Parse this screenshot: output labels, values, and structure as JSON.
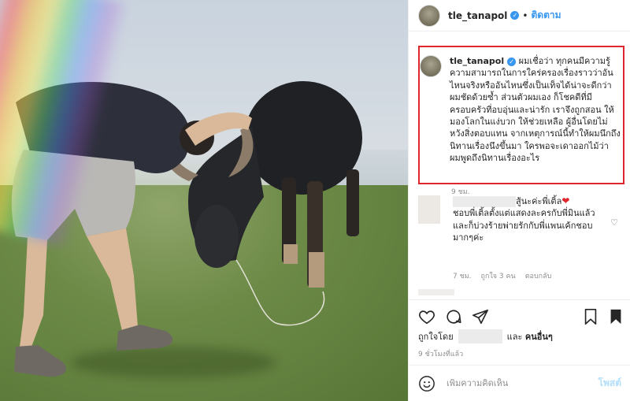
{
  "post": {
    "username": "tle_tanapol",
    "follow_label": "ติดตาม",
    "separator": "•",
    "verified_icon": "verified-badge-icon"
  },
  "caption": {
    "username": "tle_tanapol",
    "text": "ผมเชื่อว่า ทุกคนมีความรู้ความสามารถในการใคร่ครองเรื่องราวว่าอันไหนจริงหรืออันไหนซึ่งเป็นเท็จได้น่าจะดีกว่าผมชัดด้วยซ้ำ ส่วนตัวผมเอง ก็โชคดีที่มีครอบครัวที่อบอุ่นและน่ารัก เราจึงถูกสอน ให้มองโลกในแง่บวก ให้ช่วยเหลือ ผู้อื่นโดยไม่หวังสิ่งตอบแทน จากเหตุการณ์นี้ทำให้ผมนึกถึงนิทานเรื่องนึงขึ้นมา ใครพอจะเดาออกไม้ว่า ผมพูดถึงนิทานเรื่องอะไร",
    "time": "9 ชม."
  },
  "comment": {
    "text_line1_suffix": "สู้นะค่ะพี่เติ้ล",
    "text_rest": "ชอบพี่เติ้ลตั้งแต่แสดงละครกับพี่มินแล้วและก็บ่วงร้ายพ่ายรักกับพี่แพนเค้กชอบมากๆค่ะ",
    "time": "7 ชม.",
    "likes": "ถูกใจ 3 คน",
    "reply": "ตอบกลับ"
  },
  "likes": {
    "prefix": "ถูกใจโดย",
    "and": "และ",
    "others": "คนอื่นๆ"
  },
  "timestamp": "9 ชั่วโมงที่แล้ว",
  "add_comment": {
    "placeholder": "เพิ่มความคิดเห็น",
    "post_label": "โพสต์"
  },
  "colors": {
    "accent": "#3897f0",
    "highlight_border": "#e0262d",
    "heart": "#e0262d"
  }
}
